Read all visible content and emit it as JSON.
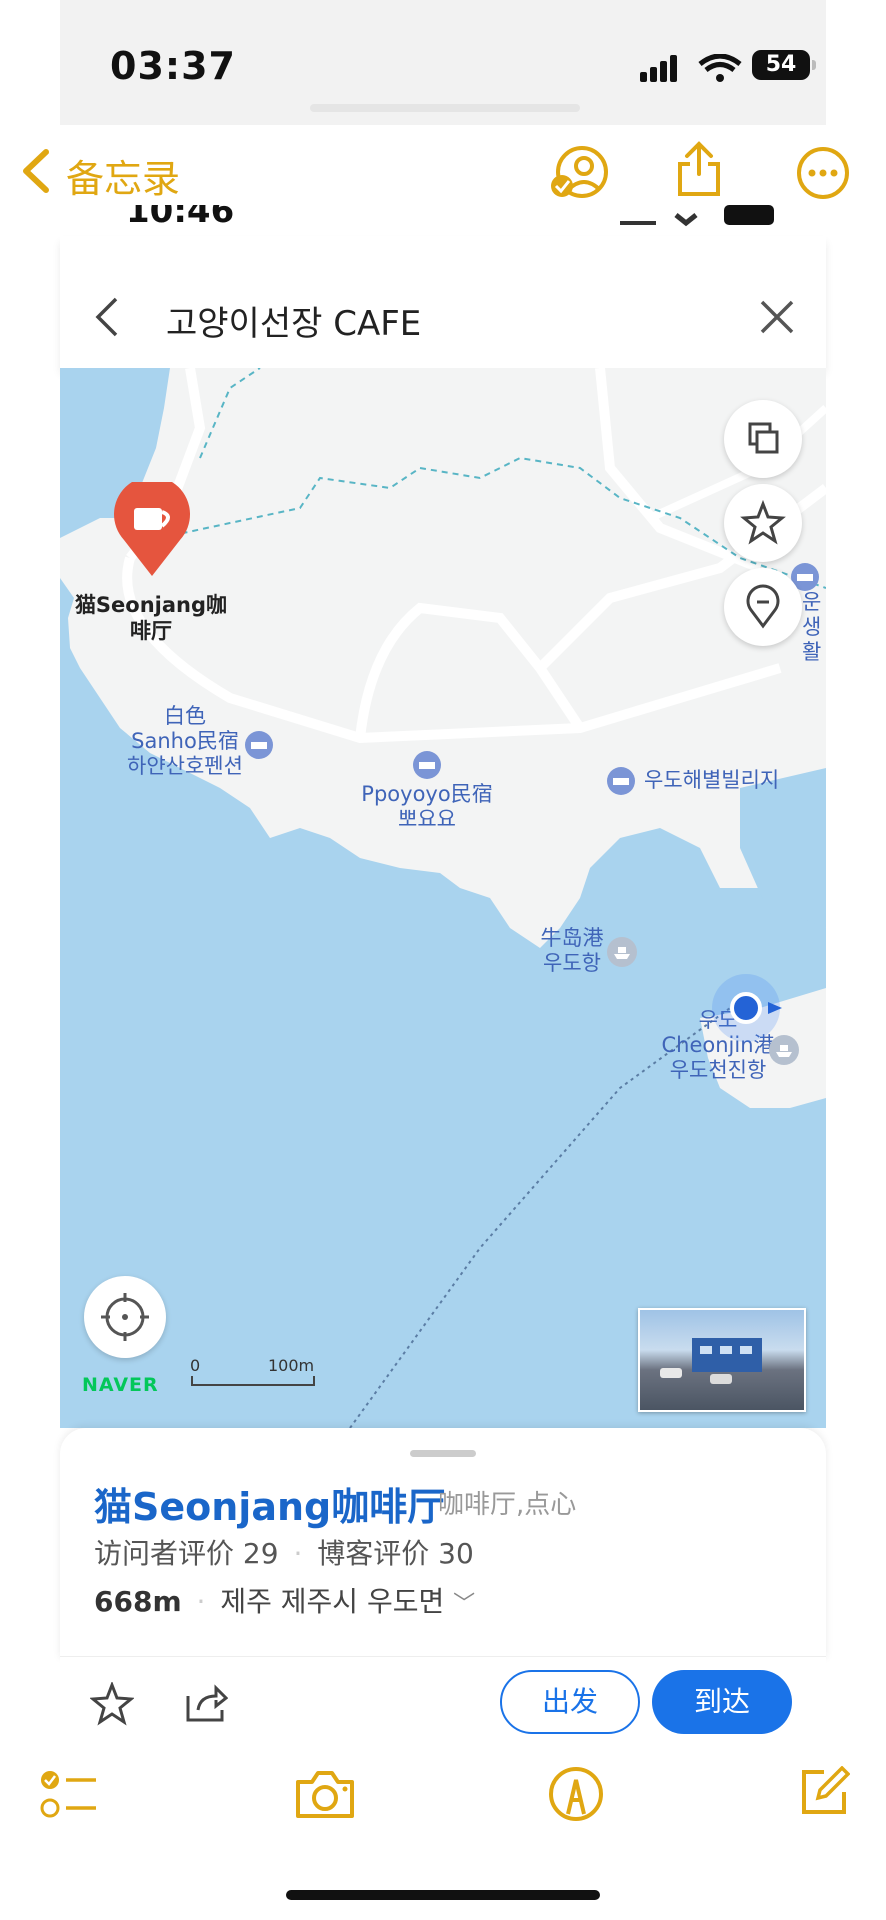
{
  "status_bar": {
    "time": "03:37",
    "battery": "54"
  },
  "notes_nav": {
    "back_label": "备忘录"
  },
  "embedded_status": {
    "time": "10:46"
  },
  "search": {
    "query": "고양이선장 CAFE"
  },
  "map": {
    "pin_label": "猫Seonjang咖\n啡厅",
    "labels": {
      "white_sanho": "白色\nSanho民宿\n하얀산호펜션",
      "ppoyoyo": "Ppoyoyo民宿\n뽀요요",
      "udo_beach": "우도해별빌리지",
      "niudo_port": "牛岛港\n우도항",
      "cheonjin": "우도\nCheonjin港\n우도천진항",
      "edge_label": "운\n생활"
    },
    "brand": "NAVER",
    "scale": {
      "zero": "0",
      "distance": "100m"
    }
  },
  "place": {
    "name": "猫Seonjang咖啡厅",
    "category": "咖啡厅,点心",
    "visitor_reviews": "访问者评价 29",
    "blog_reviews": "博客评价 30",
    "distance": "668m",
    "address": "제주 제주시 우도면"
  },
  "actions": {
    "depart": "出发",
    "arrive": "到达"
  },
  "colors": {
    "accent_yellow": "#e0a712",
    "naver_blue": "#1a73e8",
    "sea": "#a9d3ee",
    "land": "#f3f4f4"
  }
}
